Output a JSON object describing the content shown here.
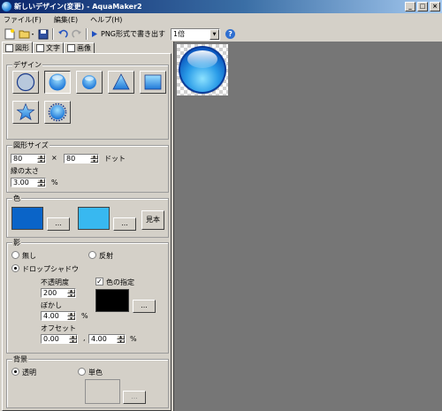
{
  "window": {
    "title": "新しいデザイン(変更) - AquaMaker2"
  },
  "menu": [
    "ファイル(F)",
    "編集(E)",
    "ヘルプ(H)"
  ],
  "toolbar": {
    "export_label": "PNG形式で書き出す",
    "zoom": "1倍"
  },
  "tabs": [
    "図形",
    "文字",
    "画像"
  ],
  "design": {
    "title": "デザイン",
    "shapes": [
      "circle-outline",
      "circle",
      "circle-small",
      "triangle",
      "square",
      "star",
      "seal"
    ],
    "selected": "circle"
  },
  "shape_size": {
    "title": "図形サイズ",
    "width": "80",
    "times": "×",
    "height": "80",
    "unit": "ドット",
    "border_label": "縁の太さ",
    "border_value": "3.00",
    "border_unit": "%"
  },
  "color": {
    "title": "色",
    "color1": "#0a64c8",
    "color2": "#38b8f0",
    "pick_label": "...",
    "sample_label": "見本"
  },
  "shadow": {
    "title": "影",
    "options": [
      "無し",
      "反射",
      "ドロップシャドウ"
    ],
    "selected": "ドロップシャドウ",
    "opacity_label": "不透明度",
    "opacity": "200",
    "blur_label": "ぼかし",
    "blur": "4.00",
    "blur_unit": "%",
    "offset_label": "オフセット",
    "offset_x": "0.00",
    "offset_sep": ",",
    "offset_y": "4.00",
    "offset_unit": "%",
    "color_check_label": "色の指定",
    "color_checked": true,
    "shadow_color": "#000000",
    "pick_label": "..."
  },
  "background": {
    "title": "背景",
    "options": [
      "透明",
      "単色"
    ],
    "selected": "透明",
    "pick_label": "..."
  }
}
